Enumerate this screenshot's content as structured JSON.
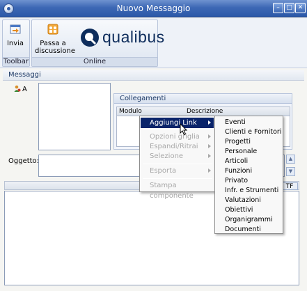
{
  "window": {
    "title": "Nuovo Messaggio"
  },
  "ribbon": {
    "send_label": "Invia",
    "discuss_label_line1": "Passa a",
    "discuss_label_line2": "discussione",
    "group_toolbar": "Toolbar",
    "group_online": "Online",
    "logo_text": "qualibus"
  },
  "section": {
    "title": "Messaggi"
  },
  "recipients": {
    "label": "A"
  },
  "links": {
    "title": "Collegamenti",
    "columns": [
      "Modulo",
      "Descrizione"
    ]
  },
  "subject": {
    "label": "Oggetto:"
  },
  "editor": {
    "format_button": "TF"
  },
  "context_menu": {
    "items": [
      {
        "label": "Aggiungi Link",
        "state": "active",
        "submenu": true
      },
      {
        "label": "Opzioni griglia",
        "state": "disabled",
        "submenu": true
      },
      {
        "label": "Espandi/Ritrai",
        "state": "disabled",
        "submenu": true
      },
      {
        "label": "Selezione",
        "state": "disabled",
        "submenu": true
      },
      {
        "label": "Esporta",
        "state": "disabled",
        "submenu": true
      },
      {
        "label": "Stampa componente",
        "state": "disabled",
        "submenu": false
      }
    ]
  },
  "submenu": {
    "items": [
      "Eventi",
      "Clienti e Fornitori",
      "Progetti",
      "Personale",
      "Articoli",
      "Funzioni",
      "Privato",
      "Infr. e Strumenti",
      "Valutazioni",
      "Obiettivi",
      "Organigrammi",
      "Documenti"
    ]
  },
  "colors": {
    "titlebar": "#3d68b5",
    "menu_highlight": "#0a246a",
    "logo": "#0e2d5c"
  }
}
